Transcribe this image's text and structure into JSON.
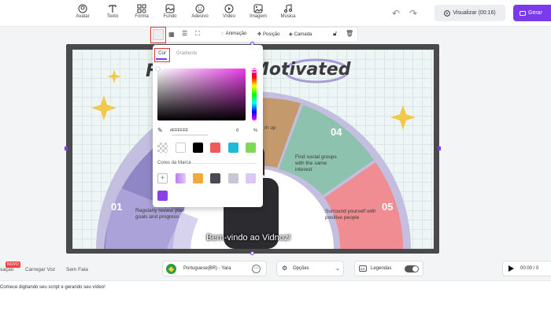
{
  "toolbar": {
    "tools": [
      {
        "label": "Avatar",
        "icon": "avatar-icon"
      },
      {
        "label": "Texto",
        "icon": "text-icon"
      },
      {
        "label": "Forma",
        "icon": "shape-icon"
      },
      {
        "label": "Fundo",
        "icon": "background-icon"
      },
      {
        "label": "Adesivo",
        "icon": "sticker-icon"
      },
      {
        "label": "Vídeo",
        "icon": "video-icon"
      },
      {
        "label": "Imagem",
        "icon": "image-icon"
      },
      {
        "label": "Música",
        "icon": "music-icon"
      }
    ],
    "preview_label": "Visualizar (00:16)",
    "generate_label": "Gerar"
  },
  "subbar": {
    "animation_label": "Animação",
    "position_label": "Posição",
    "layer_label": "Camada"
  },
  "slide": {
    "title_start": "F",
    "title_end": "Motivated",
    "segments": [
      {
        "number": "01",
        "text": "Regularly review your goals and progress"
      },
      {
        "number": "04",
        "text": "Find social groups with the same interest"
      },
      {
        "number": "05",
        "text": "Surround yourself with positive people"
      }
    ],
    "partial_text": "m up",
    "subtitle": "Bem-vindo ao Vidnoz!"
  },
  "color_picker": {
    "tab_color": "Cor",
    "tab_gradient": "Gradiente",
    "hex_value": "#FFFFFF",
    "opacity_value": "0",
    "opacity_unit": "%",
    "presets": [
      "transparent",
      "#ffffff",
      "#000000",
      "#f05a5a",
      "#22b8d8",
      "#7ed957"
    ],
    "brand_title": "Cores da Marca",
    "brand_colors": [
      "#b87ff0",
      "#f0a93a",
      "#4a4a55",
      "#c9c7d3",
      "#dcc8f5",
      "#8b3fe8"
    ]
  },
  "bottom": {
    "tab_partial": "sação",
    "badge": "NOVO",
    "upload_voice": "Carregar Voz",
    "no_speech": "Sem Fala",
    "voice": "Portuguese(BR) - Yara",
    "options": "Opções",
    "captions": "Legendas",
    "time": "00:00 / 0",
    "script_placeholder": "Comece digitando seu script e gerando seu vídeo!"
  },
  "colors": {
    "accent": "#7c3aed",
    "highlight": "#e53935"
  }
}
